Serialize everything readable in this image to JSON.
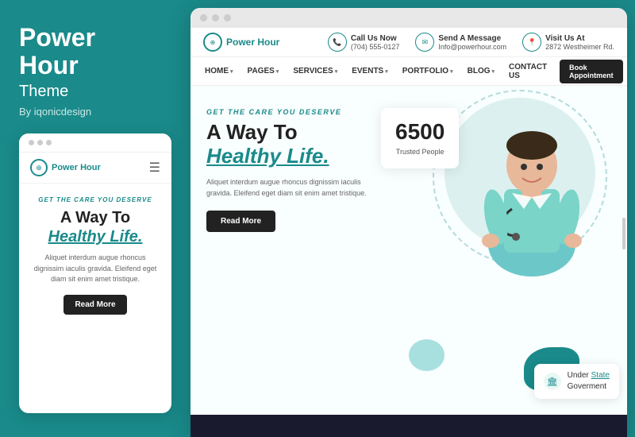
{
  "brand": {
    "title_line1": "Power",
    "title_line2": "Hour",
    "subtitle": "Theme",
    "by": "By iqonicdesign"
  },
  "mobile_preview": {
    "logo_text": "Power Hour",
    "tag": "GET THE CARE YOU DESERVE",
    "heading_line1": "A Way To",
    "heading_line2": "Healthy Life.",
    "description": "Aliquet interdum augue rhoncus dignissim iaculis gravida. Eleifend eget diam sit enim amet tristique.",
    "read_more": "Read More"
  },
  "site": {
    "logo_text": "Power Hour",
    "topbar": {
      "call_label": "Call Us Now",
      "call_value": "(704) 555-0127",
      "message_label": "Send A Message",
      "message_value": "Info@powerhour.com",
      "visit_label": "Visit Us At",
      "visit_value": "2872 Westheimer Rd."
    },
    "nav": {
      "items": [
        {
          "label": "HOME",
          "has_caret": true
        },
        {
          "label": "PAGES",
          "has_caret": true
        },
        {
          "label": "SERVICES",
          "has_caret": true
        },
        {
          "label": "EVENTS",
          "has_caret": true
        },
        {
          "label": "PORTFOLIO",
          "has_caret": true
        },
        {
          "label": "BLOG",
          "has_caret": true
        },
        {
          "label": "CONTACT US",
          "has_caret": false
        }
      ],
      "book_btn": "Book Appointment"
    },
    "hero": {
      "tag": "GET THE CARE YOU DESERVE",
      "heading_line1": "A Way To",
      "heading_line2": "Healthy Life.",
      "description": "Aliquet interdum augue rhoncus dignissim iaculis gravida. Eleifend eget diam sit enim amet\ntristique.",
      "read_more": "Read More",
      "stats_number": "6500",
      "stats_label": "Trusted People",
      "under_state_label": "Under",
      "under_state_link": "State",
      "under_state_suffix": "Goverment"
    }
  },
  "colors": {
    "teal": "#1a8a8a",
    "dark": "#222222",
    "light_teal": "#a8e0e0"
  }
}
